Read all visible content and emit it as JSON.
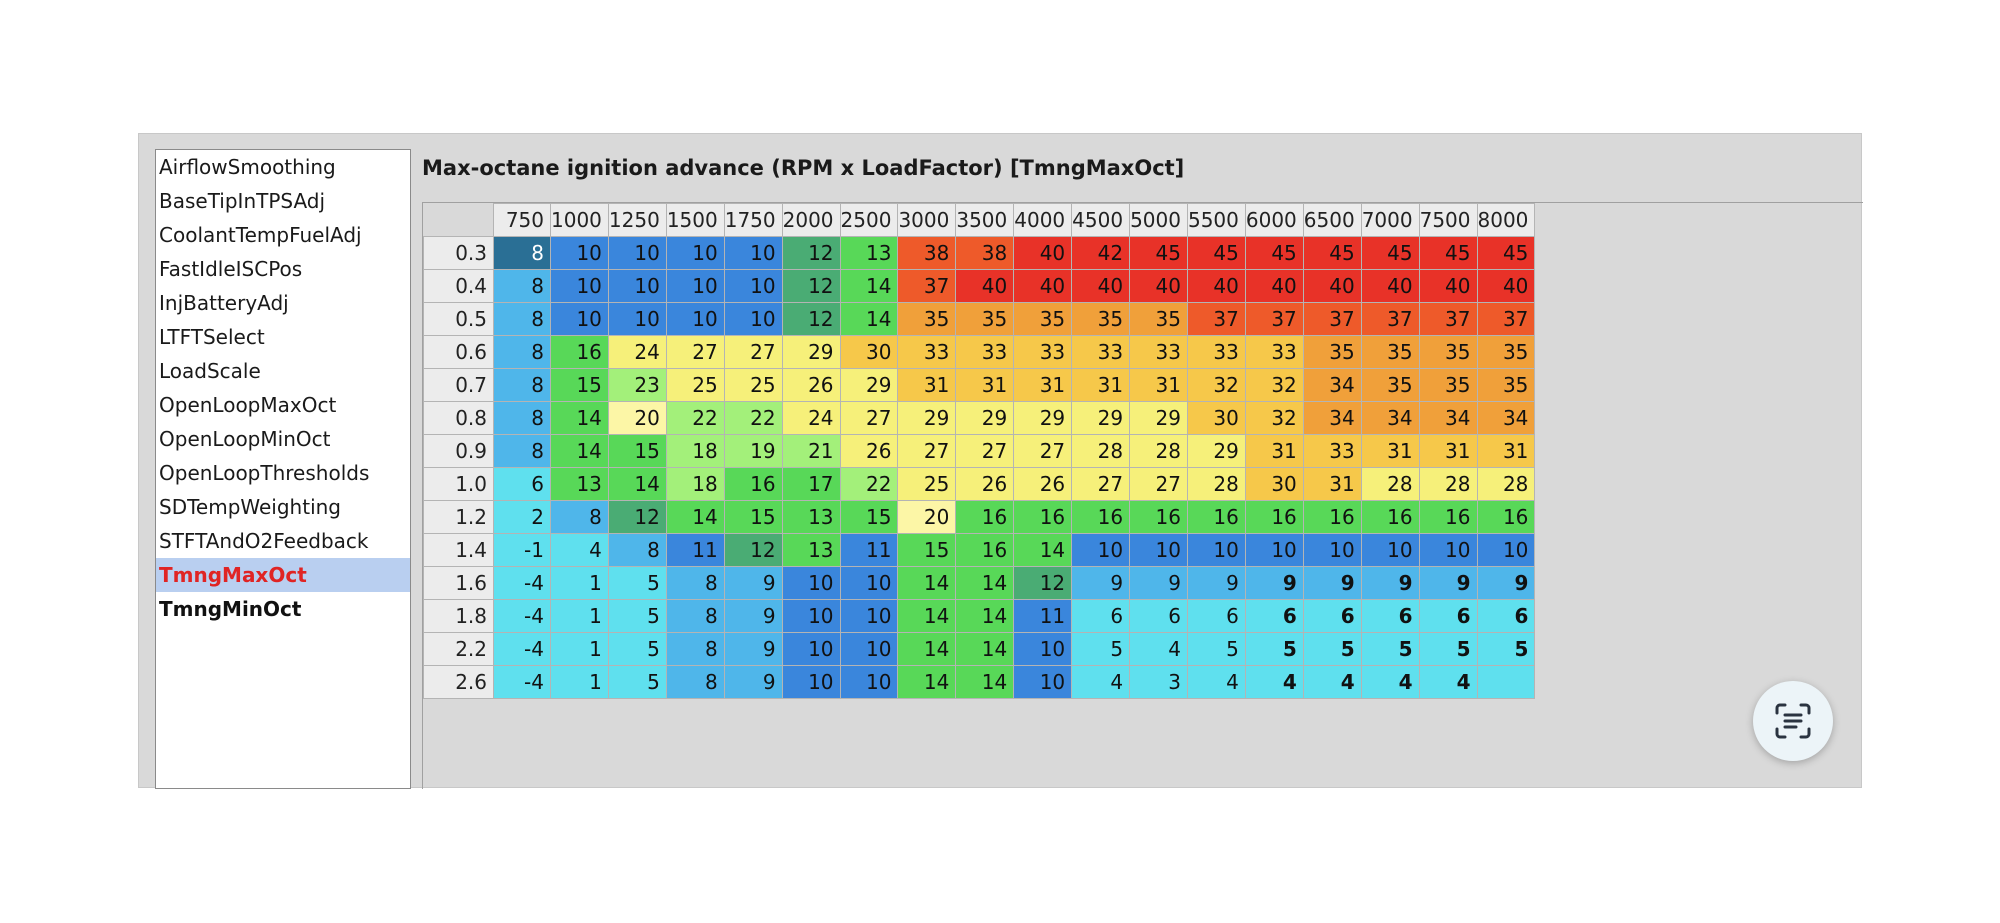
{
  "sidebar": {
    "items": [
      {
        "label": "AirflowSmoothing",
        "state": "normal"
      },
      {
        "label": "BaseTipInTPSAdj",
        "state": "normal"
      },
      {
        "label": "CoolantTempFuelAdj",
        "state": "normal"
      },
      {
        "label": "FastIdleISCPos",
        "state": "normal"
      },
      {
        "label": "InjBatteryAdj",
        "state": "normal"
      },
      {
        "label": "LTFTSelect",
        "state": "normal"
      },
      {
        "label": "LoadScale",
        "state": "normal"
      },
      {
        "label": "OpenLoopMaxOct",
        "state": "normal"
      },
      {
        "label": "OpenLoopMinOct",
        "state": "normal"
      },
      {
        "label": "OpenLoopThresholds",
        "state": "normal"
      },
      {
        "label": "SDTempWeighting",
        "state": "normal"
      },
      {
        "label": "STFTAndO2Feedback",
        "state": "normal"
      },
      {
        "label": "TmngMaxOct",
        "state": "selected"
      },
      {
        "label": "TmngMinOct",
        "state": "bold"
      }
    ]
  },
  "table": {
    "title": "Max-octane ignition advance (RPM x LoadFactor) [TmngMaxOct]",
    "columns": [
      "750",
      "1000",
      "1250",
      "1500",
      "1750",
      "2000",
      "2500",
      "3000",
      "3500",
      "4000",
      "4500",
      "5000",
      "5500",
      "6000",
      "6500",
      "7000",
      "7500",
      "8000"
    ],
    "rows": [
      {
        "label": "0.3",
        "values": [
          8,
          10,
          10,
          10,
          10,
          12,
          13,
          38,
          38,
          40,
          42,
          45,
          45,
          45,
          45,
          45,
          45,
          45
        ]
      },
      {
        "label": "0.4",
        "values": [
          8,
          10,
          10,
          10,
          10,
          12,
          14,
          37,
          40,
          40,
          40,
          40,
          40,
          40,
          40,
          40,
          40,
          40
        ]
      },
      {
        "label": "0.5",
        "values": [
          8,
          10,
          10,
          10,
          10,
          12,
          14,
          35,
          35,
          35,
          35,
          35,
          37,
          37,
          37,
          37,
          37,
          37
        ]
      },
      {
        "label": "0.6",
        "values": [
          8,
          16,
          24,
          27,
          27,
          29,
          30,
          33,
          33,
          33,
          33,
          33,
          33,
          33,
          35,
          35,
          35,
          35
        ]
      },
      {
        "label": "0.7",
        "values": [
          8,
          15,
          23,
          25,
          25,
          26,
          29,
          31,
          31,
          31,
          31,
          31,
          32,
          32,
          34,
          35,
          35,
          35
        ]
      },
      {
        "label": "0.8",
        "values": [
          8,
          14,
          20,
          22,
          22,
          24,
          27,
          29,
          29,
          29,
          29,
          29,
          30,
          32,
          34,
          34,
          34,
          34
        ]
      },
      {
        "label": "0.9",
        "values": [
          8,
          14,
          15,
          18,
          19,
          21,
          26,
          27,
          27,
          27,
          28,
          28,
          29,
          31,
          33,
          31,
          31,
          31
        ]
      },
      {
        "label": "1.0",
        "values": [
          6,
          13,
          14,
          18,
          16,
          17,
          22,
          25,
          26,
          26,
          27,
          27,
          28,
          30,
          31,
          28,
          28,
          28
        ]
      },
      {
        "label": "1.2",
        "values": [
          2,
          8,
          12,
          14,
          15,
          13,
          15,
          20,
          16,
          16,
          16,
          16,
          16,
          16,
          16,
          16,
          16,
          16
        ]
      },
      {
        "label": "1.4",
        "values": [
          -1,
          4,
          8,
          11,
          12,
          13,
          11,
          15,
          16,
          14,
          10,
          10,
          10,
          10,
          10,
          10,
          10,
          10
        ]
      },
      {
        "label": "1.6",
        "values": [
          -4,
          1,
          5,
          8,
          9,
          10,
          10,
          14,
          14,
          12,
          9,
          9,
          9,
          9,
          9,
          9,
          9,
          9
        ]
      },
      {
        "label": "1.8",
        "values": [
          -4,
          1,
          5,
          8,
          9,
          10,
          10,
          14,
          14,
          11,
          6,
          6,
          6,
          6,
          6,
          6,
          6,
          6
        ]
      },
      {
        "label": "2.2",
        "values": [
          -4,
          1,
          5,
          8,
          9,
          10,
          10,
          14,
          14,
          10,
          5,
          4,
          5,
          5,
          5,
          5,
          5,
          5
        ]
      },
      {
        "label": "2.6",
        "values": [
          -4,
          1,
          5,
          8,
          9,
          10,
          10,
          14,
          14,
          10,
          4,
          3,
          4,
          4,
          4,
          4,
          4,
          ""
        ]
      }
    ],
    "colors": {
      "dark_blue": "#2a6f95",
      "blue": "#3a86dc",
      "teal_green": "#4aac74",
      "green": "#58d858",
      "light_green": "#a3f07a",
      "yellow": "#f6f07a",
      "pale_yellow": "#fcf6a6",
      "orange": "#f0a03a",
      "red_orange": "#ee5a2a",
      "red": "#e83228",
      "cyan": "#5fe0ee",
      "sky": "#4fb6ea"
    }
  },
  "fab": {
    "icon": "text-scan-icon"
  }
}
